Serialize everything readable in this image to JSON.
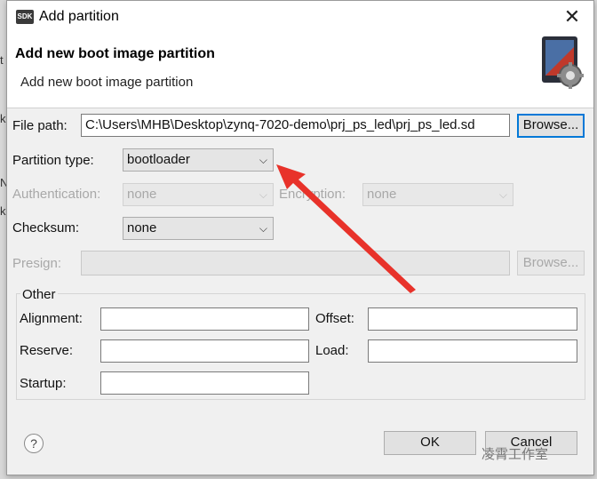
{
  "window": {
    "app_icon_text": "SDK",
    "title": "Add partition",
    "close_glyph": "✕"
  },
  "header": {
    "title": "Add new boot image partition",
    "description": "Add new boot image partition"
  },
  "form": {
    "file_path_label": "File path:",
    "file_path_value": "C:\\Users\\MHB\\Desktop\\zynq-7020-demo\\prj_ps_led\\prj_ps_led.sd",
    "browse_label": "Browse...",
    "partition_type_label": "Partition type:",
    "partition_type_value": "bootloader",
    "authentication_label": "Authentication:",
    "authentication_value": "none",
    "encryption_label": "Encryption:",
    "encryption_value": "none",
    "checksum_label": "Checksum:",
    "checksum_value": "none",
    "presign_label": "Presign:",
    "presign_value": "",
    "presign_browse_label": "Browse..."
  },
  "other": {
    "group_title": "Other",
    "alignment_label": "Alignment:",
    "alignment_value": "",
    "offset_label": "Offset:",
    "offset_value": "",
    "reserve_label": "Reserve:",
    "reserve_value": "",
    "load_label": "Load:",
    "load_value": "",
    "startup_label": "Startup:",
    "startup_value": ""
  },
  "footer": {
    "help_glyph": "?",
    "ok_label": "OK",
    "cancel_label": "Cancel"
  },
  "watermark": "凌霄工作室",
  "icons": {
    "app": "sdk-icon",
    "close": "close-icon",
    "header": "boot-image-gear-icon",
    "help": "help-icon",
    "dropdown": "chevron-down-icon",
    "annotation": "red-arrow-annotation"
  },
  "colors": {
    "accent_focus": "#0078d7",
    "annotation_arrow": "#e8322a"
  }
}
